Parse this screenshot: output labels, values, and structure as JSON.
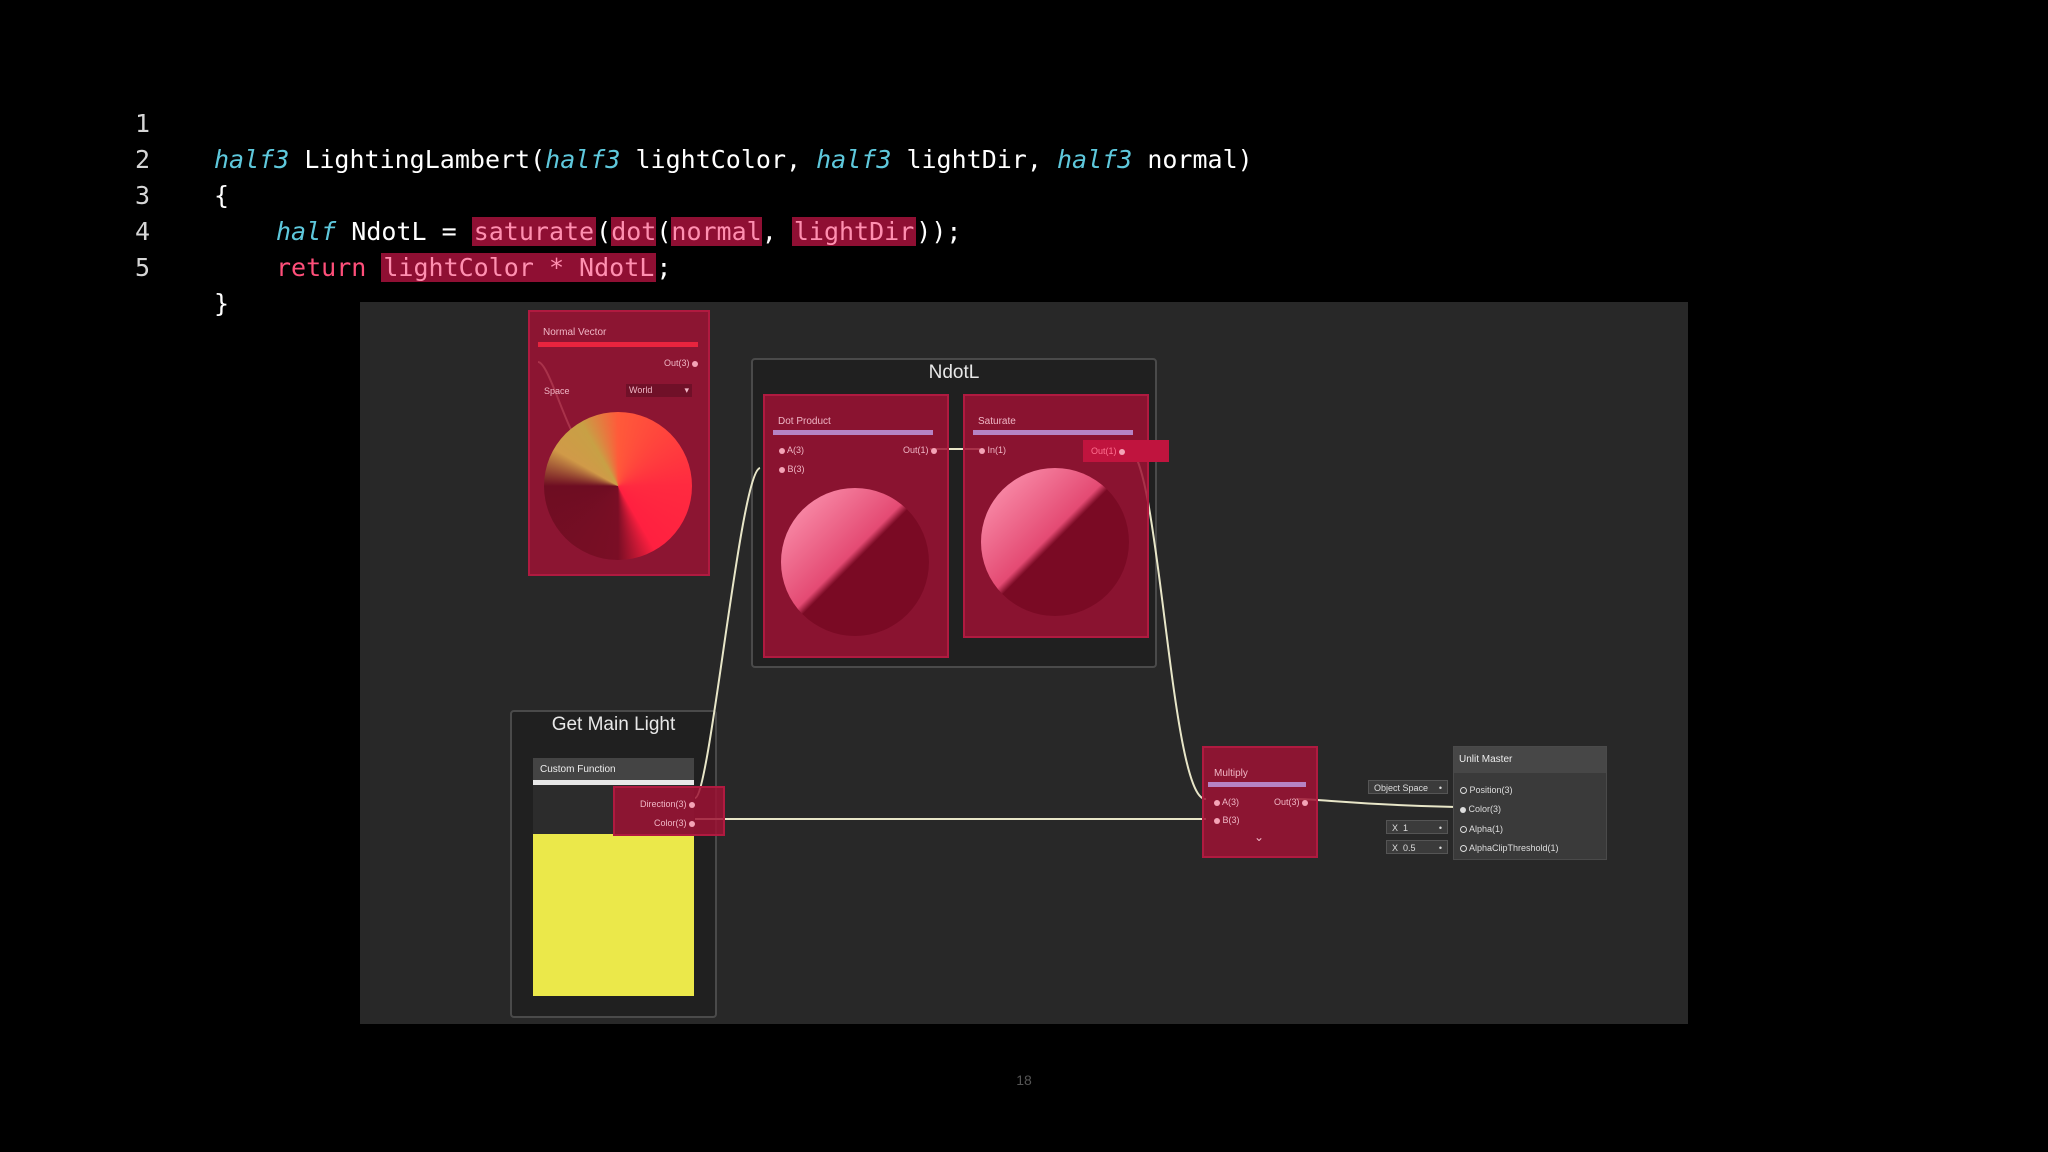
{
  "code": {
    "line_numbers": [
      "1",
      "2",
      "3",
      "4",
      "5"
    ],
    "line1": {
      "t1": "half3",
      "fn": "LightingLambert(",
      "t2": "half3",
      "a1": "lightColor,",
      "t3": "half3",
      "a2": "lightDir,",
      "t4": "half3",
      "a3": "normal)"
    },
    "line2": "{",
    "line3": {
      "type": "half",
      "var": "NdotL =",
      "saturate": "saturate",
      "lp1": "(",
      "dot": "dot",
      "lp2": "(",
      "normal": "normal",
      "comma": ",",
      "lightdir": "lightDir",
      "tail": "));"
    },
    "line4": {
      "kw": "return",
      "expr": "lightColor * NdotL",
      "semi": ";"
    },
    "line5": "}"
  },
  "graph": {
    "normal_vector": {
      "title": "Normal Vector",
      "out": "Out(3)",
      "space_label": "Space",
      "space_value": "World"
    },
    "ndotl_group": {
      "title": "NdotL"
    },
    "dot_product": {
      "title": "Dot Product",
      "in_a": "A(3)",
      "in_b": "B(3)",
      "out": "Out(1)"
    },
    "saturate": {
      "title": "Saturate",
      "in": "In(1)",
      "out": "Out(1)"
    },
    "get_main_light": {
      "title": "Get Main Light",
      "custom_function": "Custom Function",
      "out_direction": "Direction(3)",
      "out_color": "Color(3)"
    },
    "multiply": {
      "title": "Multiply",
      "in_a": "A(3)",
      "in_b": "B(3)",
      "out": "Out(3)"
    },
    "unlit_master": {
      "title": "Unlit Master",
      "ports": [
        "Position(3)",
        "Color(3)",
        "Alpha(1)",
        "AlphaClipThreshold(1)"
      ],
      "position_space": "Object Space",
      "alpha_value": "1",
      "alpha_clip_value": "0.5",
      "x_label": "X"
    }
  },
  "page_number": "18",
  "colors": {
    "background": "#000000",
    "graph_bg": "#282828",
    "highlight": "#9e1234",
    "type_keyword": "#5ec8dc",
    "return_keyword": "#ff4f7a",
    "light_color": "#ebe84a"
  }
}
